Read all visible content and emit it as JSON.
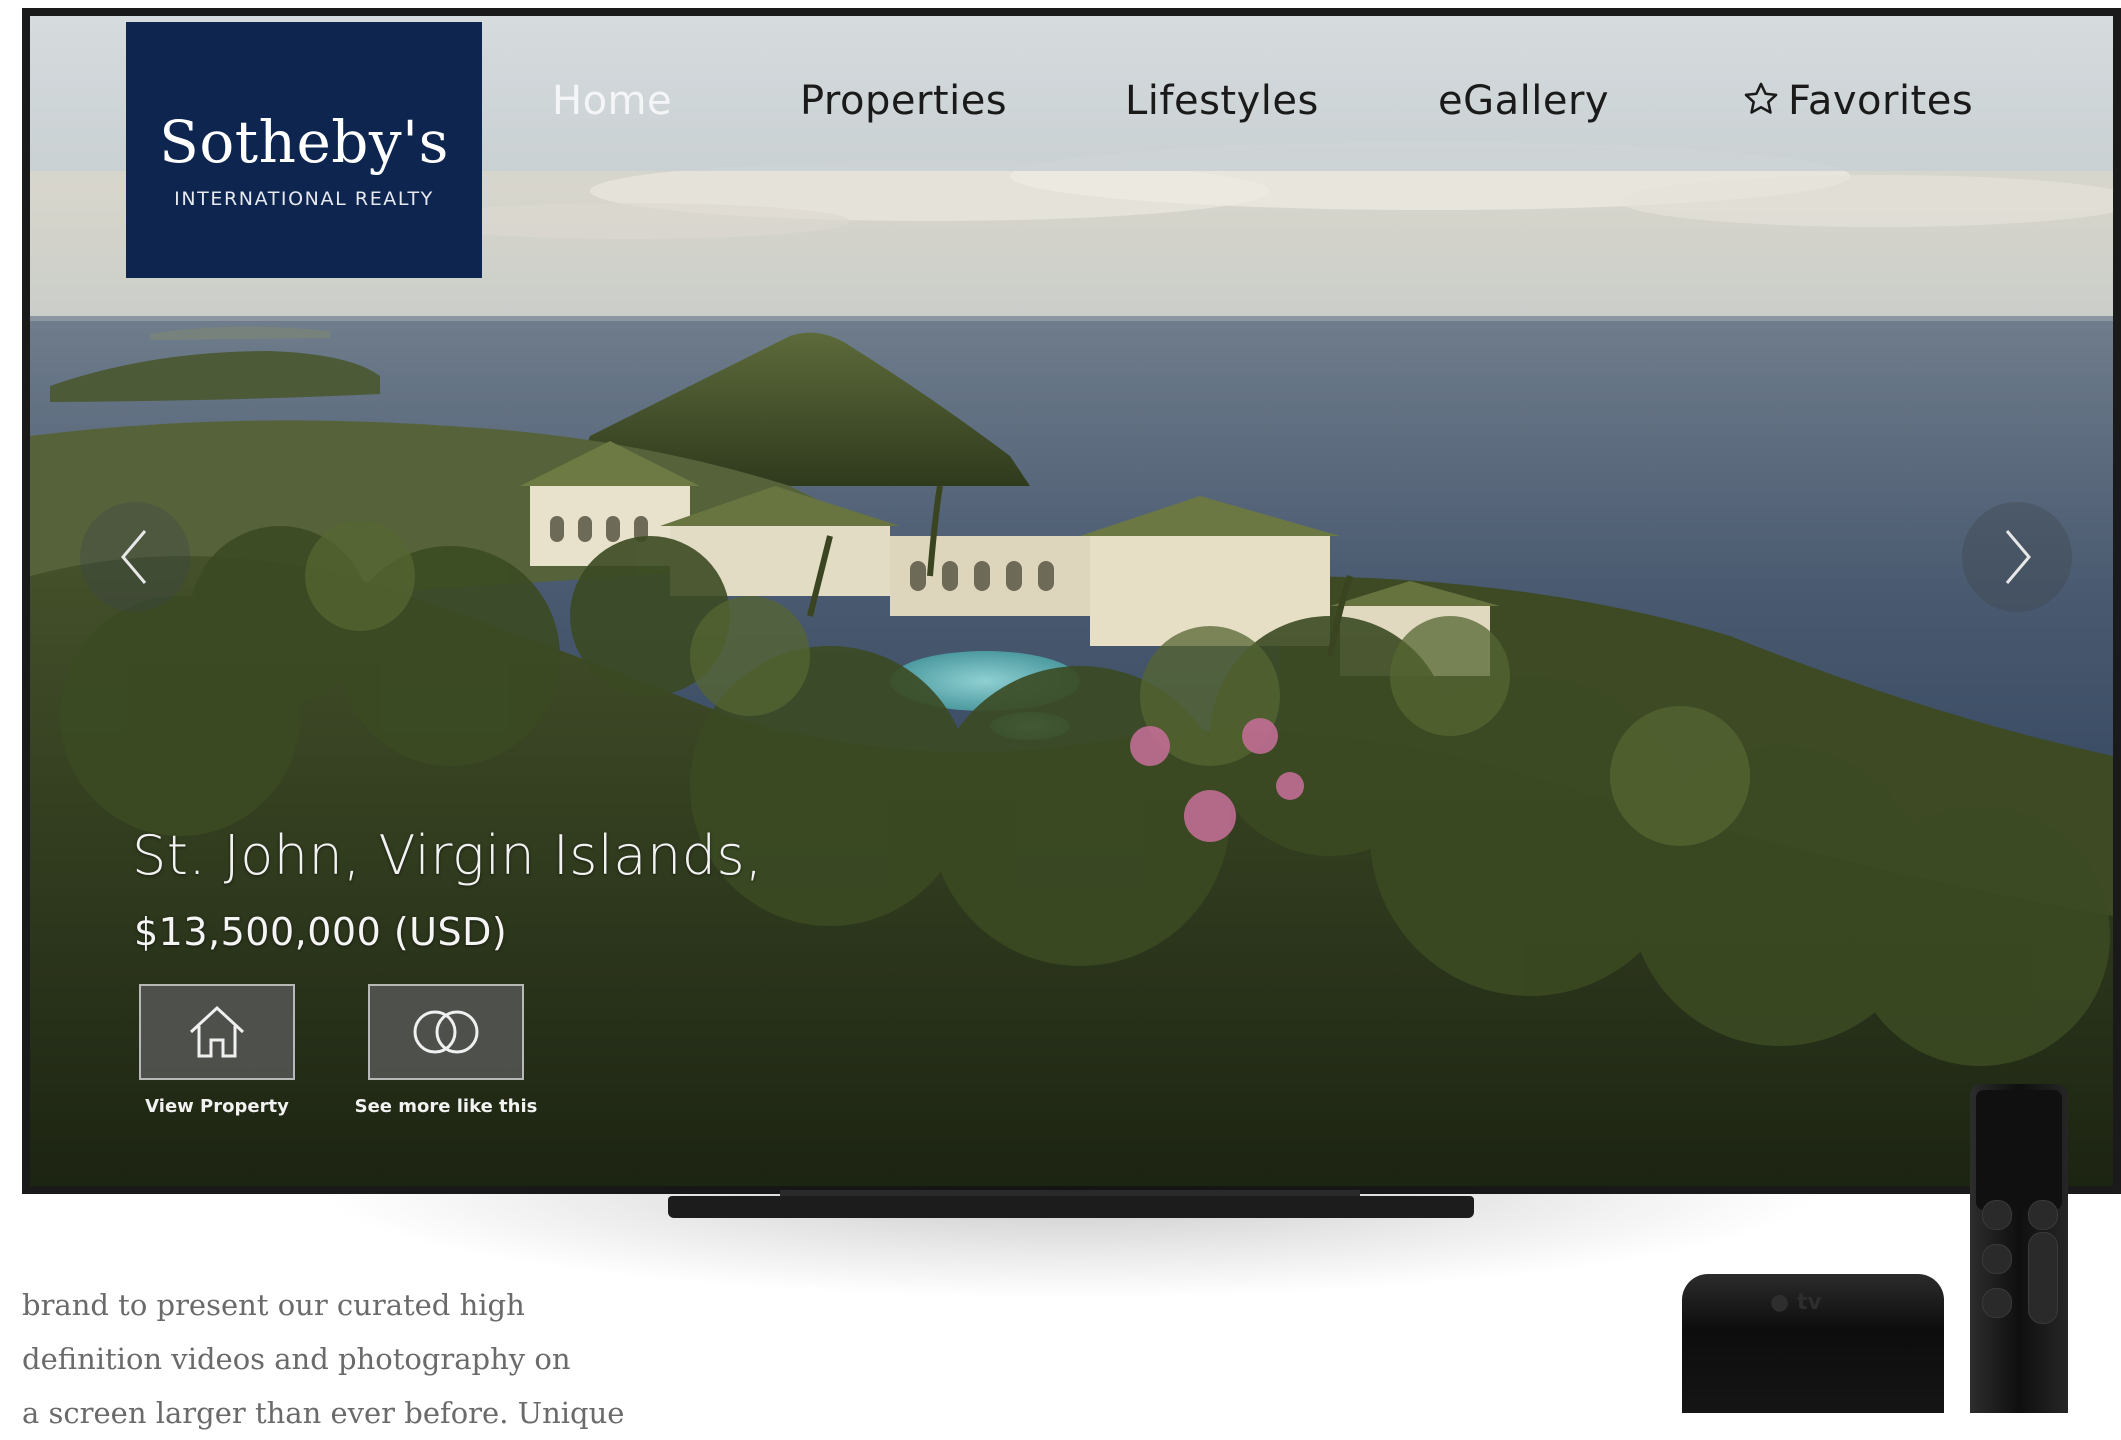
{
  "nav": {
    "items": [
      {
        "label": "Home",
        "active": true
      },
      {
        "label": "Properties",
        "active": false
      },
      {
        "label": "Lifestyles",
        "active": false
      },
      {
        "label": "eGallery",
        "active": false
      },
      {
        "label": "Favorites",
        "active": false,
        "icon": "star-icon"
      }
    ]
  },
  "logo": {
    "name": "Sotheby's",
    "subtitle": "INTERNATIONAL REALTY",
    "color": "#0e2550"
  },
  "listing": {
    "location": "St. John, Virgin Islands,",
    "price": "$13,500,000 (USD)"
  },
  "actions": [
    {
      "label": "View Property",
      "icon": "house-icon"
    },
    {
      "label": "See more like this",
      "icon": "interlocking-rings-icon"
    }
  ],
  "carousel": {
    "prev_icon": "chevron-left-icon",
    "next_icon": "chevron-right-icon"
  },
  "article": {
    "lines": [
      "brand to present our curated high",
      "definition videos and photography on",
      "a screen larger than ever before. Unique"
    ]
  },
  "devices": {
    "box_label": "tv"
  }
}
